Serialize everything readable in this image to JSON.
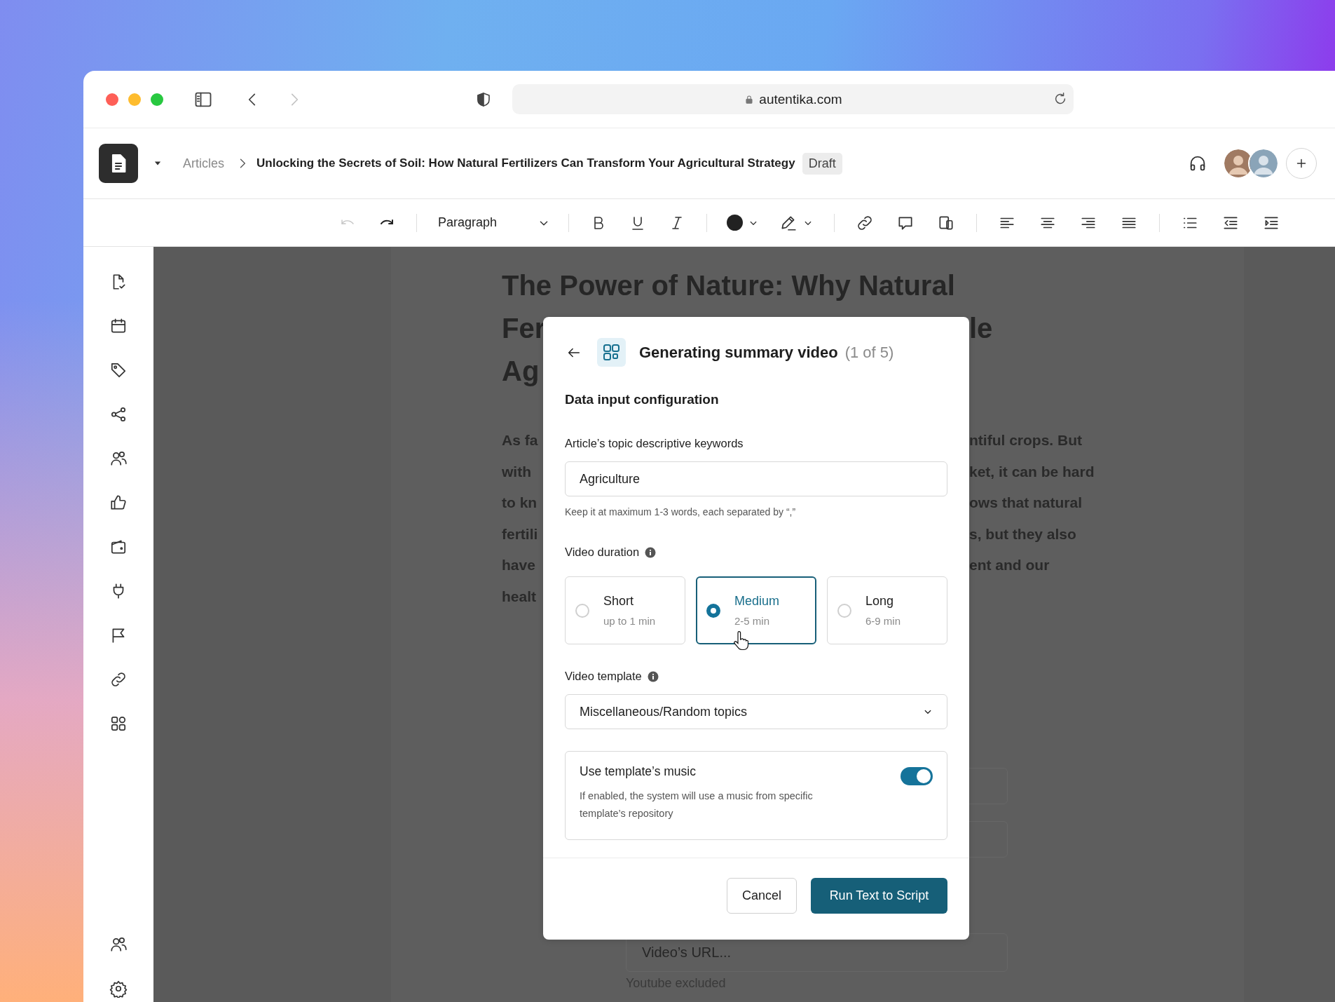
{
  "browser": {
    "url": "autentika.com",
    "nav": [
      {
        "kind": "back",
        "disabled": false
      },
      {
        "kind": "forward",
        "disabled": true
      }
    ]
  },
  "header": {
    "breadcrumb": "Articles",
    "title": "Unlocking the Secrets of Soil: How Natural Fertilizers Can Transform Your Agricultural Strategy",
    "status": "Draft"
  },
  "toolbar": {
    "history": [
      {
        "kind": "undo",
        "disabled": true
      },
      {
        "kind": "redo",
        "disabled": false
      }
    ],
    "block_style": "Paragraph"
  },
  "article": {
    "title_first_line": "The Power of Nature: Why Natural",
    "title_cut_lines": [
      {
        "left": "Fer",
        "right": "le"
      },
      {
        "left": "Ag"
      }
    ],
    "paragraph_lines": [
      {
        "left": "As fa",
        "right": "ntiful crops. But"
      },
      {
        "left": "with",
        "right": "ket, it can be hard"
      },
      {
        "left": "to kn",
        "right": "ows that natural"
      },
      {
        "left": "fertili",
        "right": "s, but they also"
      },
      {
        "left": "have",
        "right": "ent and our"
      },
      {
        "left": "healt"
      }
    ],
    "url_placeholder": "Video’s URL...",
    "url_hint": "Youtube excluded"
  },
  "dialog": {
    "title": "Generating summary video",
    "step": "(1 of 5)",
    "section": "Data input configuration",
    "keywords": {
      "label": "Article’s topic descriptive keywords",
      "value": "Agriculture",
      "hint": "Keep it at maximum 1-3 words, each separated by “,”"
    },
    "duration": {
      "label": "Video duration",
      "options": [
        {
          "label": "Short",
          "sub": "up to 1 min",
          "selected": false
        },
        {
          "label": "Medium",
          "sub": "2-5 min",
          "selected": true
        },
        {
          "label": "Long",
          "sub": "6-9 min",
          "selected": false
        }
      ]
    },
    "template": {
      "label": "Video template",
      "value": "Miscellaneous/Random topics"
    },
    "music": {
      "label": "Use template’s music",
      "description": "If enabled, the system will use a music from specific template’s repository",
      "on": true
    },
    "buttons": {
      "cancel": "Cancel",
      "primary": "Run Text to Script"
    }
  }
}
